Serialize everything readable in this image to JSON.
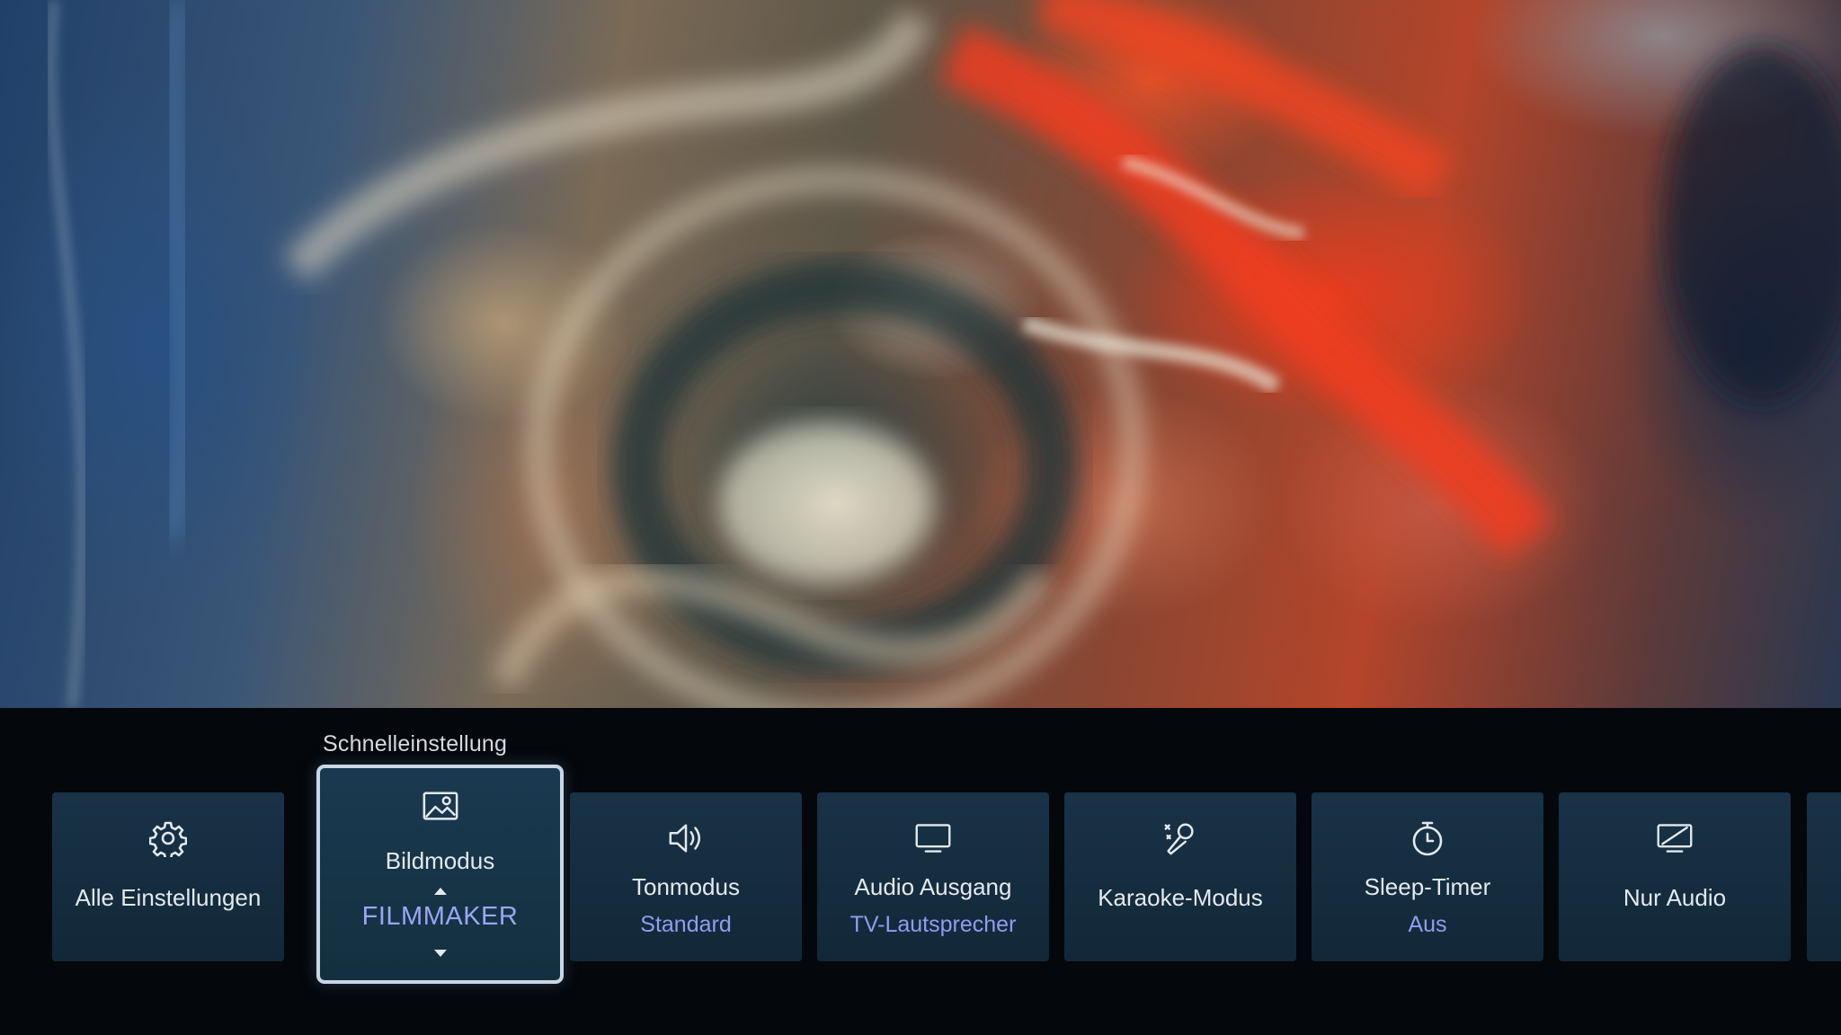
{
  "quick_settings": {
    "title": "Schnelleinstellung",
    "tiles": [
      {
        "icon": "gear-icon",
        "label": "Alle Einstellungen",
        "value": ""
      },
      {
        "icon": "picture-icon",
        "label": "Bildmodus",
        "value": "FILMMAKER",
        "selected": true
      },
      {
        "icon": "speaker-icon",
        "label": "Tonmodus",
        "value": "Standard"
      },
      {
        "icon": "monitor-icon",
        "label": "Audio Ausgang",
        "value": "TV-Lautsprecher"
      },
      {
        "icon": "microphone-icon",
        "label": "Karaoke-Modus",
        "value": ""
      },
      {
        "icon": "timer-icon",
        "label": "Sleep-Timer",
        "value": "Aus"
      },
      {
        "icon": "screen-off-icon",
        "label": "Nur Audio",
        "value": ""
      }
    ]
  },
  "colors": {
    "tile_bg": "#183247",
    "value_text": "#8f9df0",
    "focus_border": "#c9d7e4"
  }
}
